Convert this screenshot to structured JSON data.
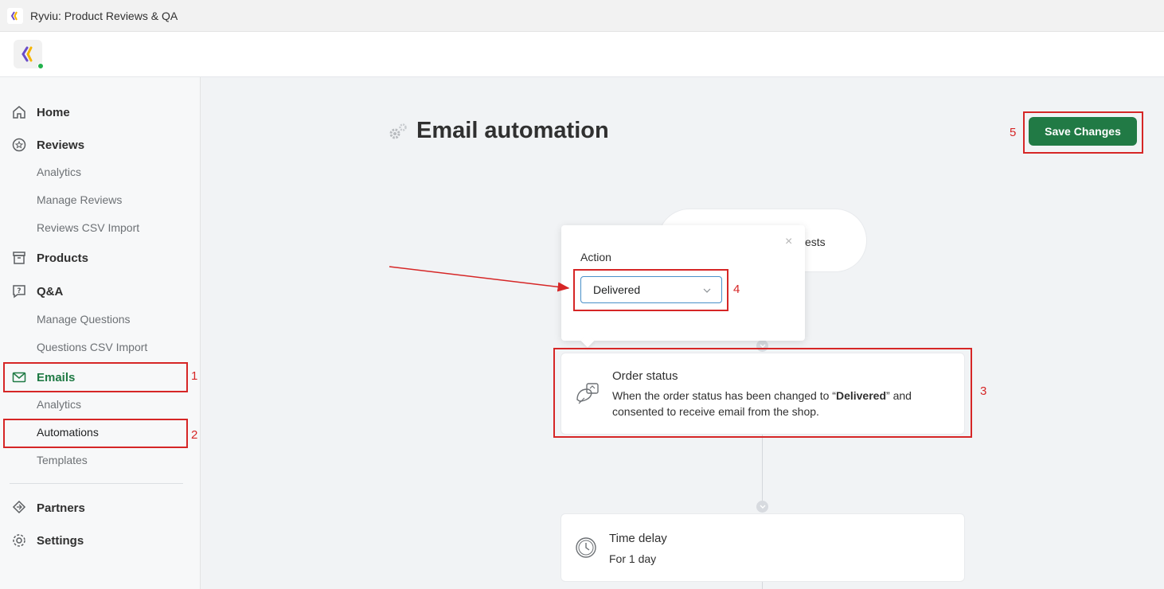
{
  "window": {
    "title": "Ryviu: Product Reviews & QA"
  },
  "sidebar": {
    "home": "Home",
    "reviews": "Reviews",
    "reviews_sub": [
      "Analytics",
      "Manage Reviews",
      "Reviews CSV Import"
    ],
    "products": "Products",
    "qa": "Q&A",
    "qa_sub": [
      "Manage Questions",
      "Questions CSV Import"
    ],
    "emails": "Emails",
    "emails_sub": [
      "Analytics",
      "Automations",
      "Templates"
    ],
    "partners": "Partners",
    "settings": "Settings"
  },
  "main": {
    "title": "Email automation",
    "save_label": "Save Changes",
    "trigger_partial": "ests",
    "popover": {
      "label": "Action",
      "selected": "Delivered",
      "close_glyph": "×"
    },
    "order_card": {
      "title": "Order status",
      "desc_before": "When the order status has been changed to “",
      "desc_bold": "Delivered",
      "desc_after": "” and consented to receive email from the shop."
    },
    "delay_card": {
      "title": "Time delay",
      "desc": "For 1 day"
    }
  },
  "annotations": [
    "1",
    "2",
    "3",
    "4",
    "5"
  ],
  "colors": {
    "accent": "#217a45",
    "active_nav": "#1f7a44",
    "annotation": "#d62626",
    "select_border": "#4a90c9"
  },
  "icons": [
    "home-icon",
    "reviews-icon",
    "products-icon",
    "qa-icon",
    "email-icon",
    "partners-icon",
    "settings-icon",
    "gear-icon",
    "chevron-down-icon",
    "close-icon",
    "order-status-icon",
    "clock-icon"
  ]
}
